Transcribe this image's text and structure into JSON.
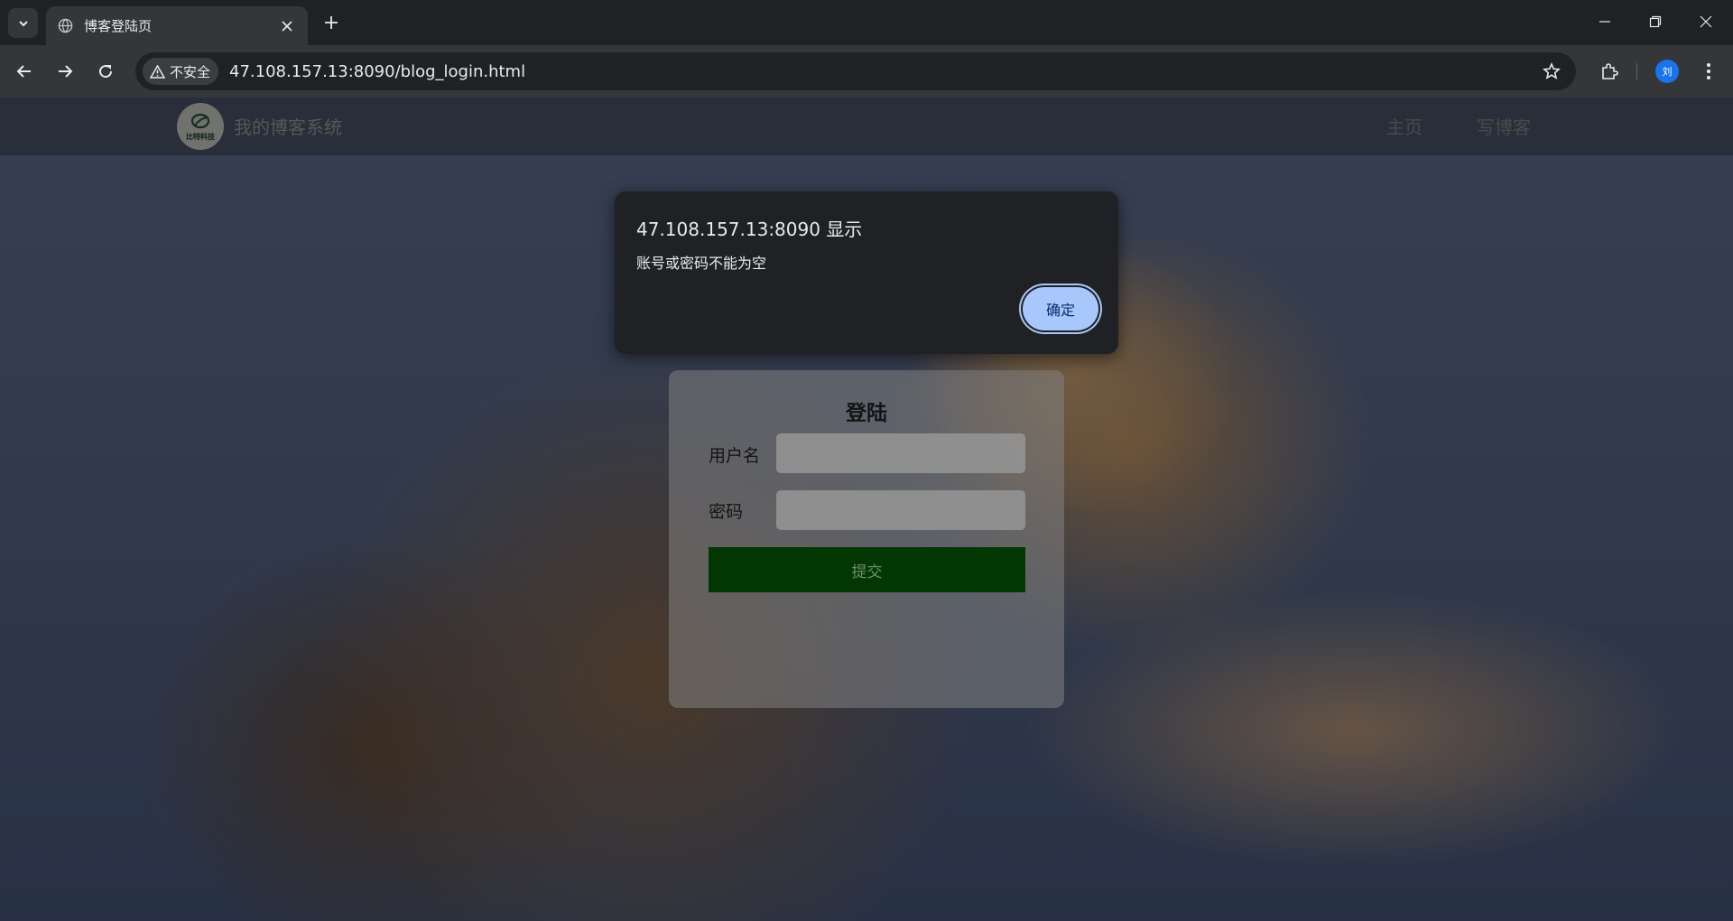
{
  "browser": {
    "tab_title": "博客登陆页",
    "security_label": "不安全",
    "url": "47.108.157.13:8090/blog_login.html",
    "profile_initial": "刘",
    "icons": [
      "chevron-down-icon",
      "globe-icon",
      "close-icon",
      "plus-icon",
      "minimize-icon",
      "restore-icon",
      "close-window-icon",
      "back-arrow-icon",
      "forward-arrow-icon",
      "reload-icon",
      "warning-icon",
      "star-icon",
      "extension-icon",
      "more-vert-icon"
    ]
  },
  "site": {
    "logo_text": "比特科技",
    "title": "我的博客系统",
    "nav": {
      "home": "主页",
      "write": "写博客"
    }
  },
  "login": {
    "title": "登陆",
    "username_label": "用户名",
    "password_label": "密码",
    "submit_label": "提交"
  },
  "alert": {
    "title": "47.108.157.13:8090 显示",
    "message": "账号或密码不能为空",
    "ok_label": "确定"
  },
  "colors": {
    "alert_button": "#a8c7fa",
    "submit_button": "#023602",
    "chrome_dark": "#202124"
  }
}
